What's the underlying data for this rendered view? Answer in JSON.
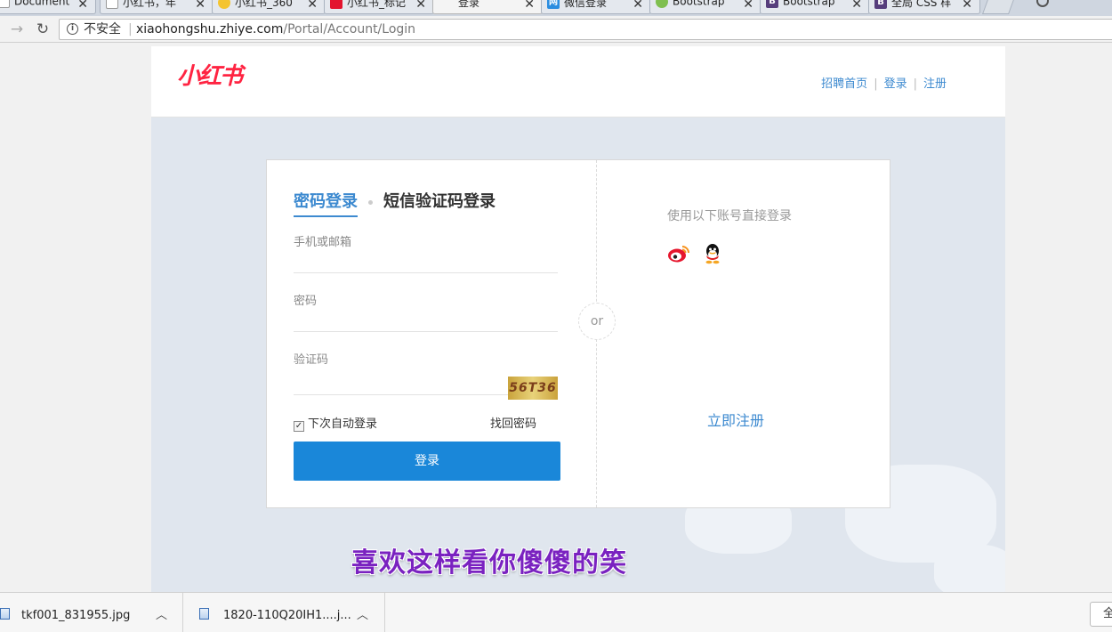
{
  "browser": {
    "tabs": [
      {
        "title": "Document",
        "icon": "document-icon",
        "active": false
      },
      {
        "title": "小红书，年",
        "icon": "page-icon",
        "active": false
      },
      {
        "title": "小红书_360",
        "icon": "chrome-icon",
        "active": false
      },
      {
        "title": "小红书_标记",
        "icon": "xhs-icon",
        "active": false
      },
      {
        "title": "登录",
        "icon": "none",
        "active": true
      },
      {
        "title": "微信登录",
        "icon": "wechat-icon",
        "active": false
      },
      {
        "title": "Bootstrap",
        "icon": "bootstrap-icon",
        "active": false
      },
      {
        "title": "Bootstrap",
        "icon": "bootstrap-b-icon",
        "active": false
      },
      {
        "title": "全局 CSS 样",
        "icon": "bootstrap-b-icon",
        "active": false
      }
    ],
    "address": {
      "security_label": "不安全",
      "host": "xiaohongshu.zhiye.com",
      "path": "/Portal/Account/Login"
    }
  },
  "header": {
    "logo": "小红书",
    "links": [
      "招聘首页",
      "登录",
      "注册"
    ]
  },
  "login": {
    "tab_password": "密码登录",
    "tab_sms": "短信验证码登录",
    "fields": {
      "account_label": "手机或邮箱",
      "password_label": "密码",
      "captcha_label": "验证码",
      "captcha_text": "56T36"
    },
    "remember_label": "下次自动登录",
    "remember_checked": true,
    "forgot_label": "找回密码",
    "submit_label": "登录",
    "or_label": "or",
    "social_title": "使用以下账号直接登录",
    "social_icons": [
      "weibo-icon",
      "qq-icon"
    ],
    "register_label": "立即注册"
  },
  "overlay_subtitle": "喜欢这样看你傻傻的笑",
  "downloads": [
    {
      "name": "tkf001_831955.jpg"
    },
    {
      "name": "1820-110Q20IH1....j..."
    }
  ],
  "downloads_show_all": "全",
  "colors": {
    "brand_red": "#ff2442",
    "link_blue": "#3d8ad0",
    "button_blue": "#1a87d9",
    "subtitle_purple": "#7a22c0"
  }
}
